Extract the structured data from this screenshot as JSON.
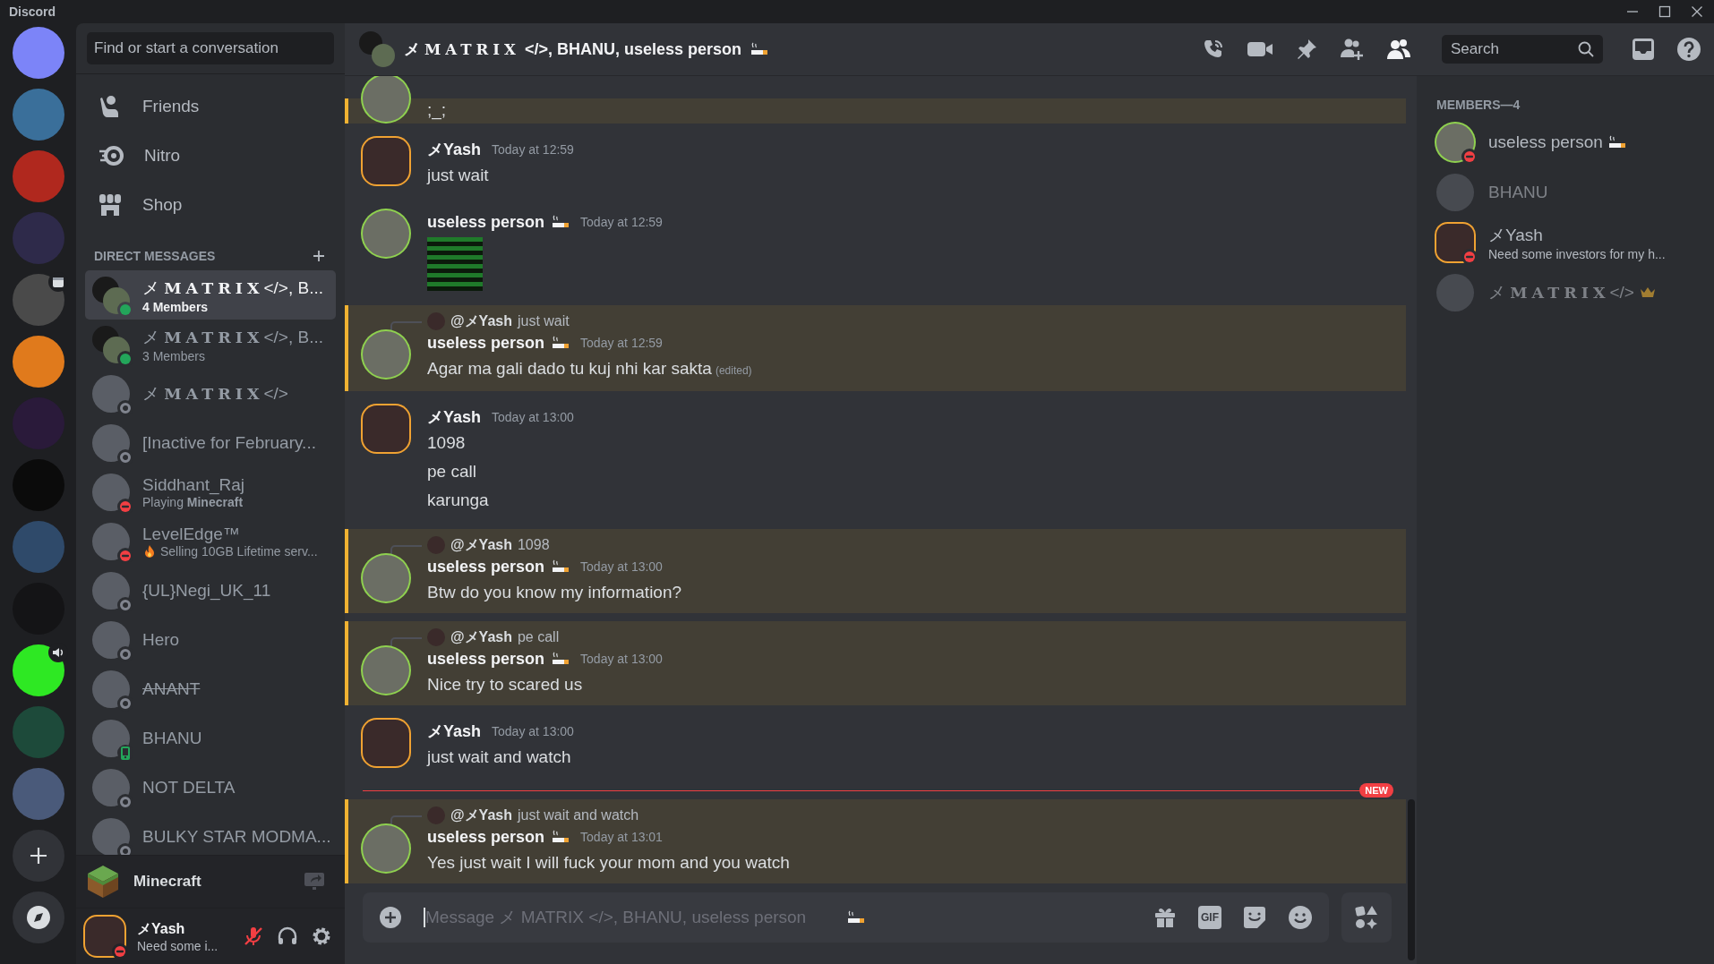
{
  "titlebar": {
    "title": "Discord"
  },
  "servers": [
    {
      "color": "#7c84f8",
      "kind": "plain"
    },
    {
      "color": "#3a6f9a",
      "kind": "plain"
    },
    {
      "color": "#b0281e",
      "kind": "plain"
    },
    {
      "color": "#2e2a4a",
      "kind": "plain"
    },
    {
      "color": "#4a4a4a",
      "kind": "calendar"
    },
    {
      "color": "#e07a1c",
      "kind": "plain"
    },
    {
      "color": "#2a1a3a",
      "kind": "plain"
    },
    {
      "color": "#0b0b0b",
      "kind": "plain"
    },
    {
      "color": "#2f4a6a",
      "kind": "plain"
    },
    {
      "color": "#141416",
      "kind": "plain"
    },
    {
      "color": "#2ee823",
      "kind": "speaker"
    },
    {
      "color": "#1d4a3a",
      "kind": "plain"
    },
    {
      "color": "#4a5a7a",
      "kind": "plain"
    }
  ],
  "search": {
    "placeholder": "Find or start a conversation"
  },
  "nav": [
    {
      "kind": "friends",
      "label": "Friends"
    },
    {
      "kind": "nitro",
      "label": "Nitro"
    },
    {
      "kind": "shop",
      "label": "Shop"
    }
  ],
  "dm_heading": "DIRECT MESSAGES",
  "dms": [
    {
      "name": "メ **MATRIX**</>, B...",
      "sub": "4 Members",
      "kind": "online",
      "group": true,
      "struck": false,
      "fire_icon": false,
      "selected": true
    },
    {
      "name": "メ **MATRIX**</>, B...",
      "sub": "3 Members",
      "kind": "online",
      "group": true,
      "struck": false,
      "fire_icon": false,
      "selected": false
    },
    {
      "name": "メ **MATRIX**</>",
      "kind": "offline",
      "group": false,
      "struck": false,
      "fire_icon": false,
      "selected": false
    },
    {
      "name": "[Inactive for February...",
      "kind": "offline",
      "group": false,
      "struck": false,
      "fire_icon": false,
      "selected": false
    },
    {
      "name": "Siddhant_Raj",
      "sub": "Playing **Minecraft**",
      "kind": "dnd",
      "group": false,
      "struck": false,
      "fire_icon": false,
      "selected": false
    },
    {
      "name": "LevelEdge™",
      "sub": "Selling 10GB Lifetime serv...",
      "kind": "dnd",
      "group": false,
      "struck": false,
      "fire_icon": true,
      "selected": false
    },
    {
      "name": "{UL}Negi_UK_11",
      "kind": "offline",
      "group": false,
      "struck": false,
      "fire_icon": false,
      "selected": false
    },
    {
      "name": "Hero",
      "kind": "offline",
      "group": false,
      "struck": false,
      "fire_icon": false,
      "selected": false
    },
    {
      "name": "ANANT",
      "kind": "offline",
      "group": false,
      "struck": true,
      "fire_icon": false,
      "selected": false
    },
    {
      "name": "BHANU",
      "kind": "mobile",
      "group": false,
      "struck": false,
      "fire_icon": false,
      "selected": false
    },
    {
      "name": "NOT DELTA",
      "kind": "offline",
      "group": false,
      "struck": false,
      "fire_icon": false,
      "selected": false
    },
    {
      "name": "BULKY STAR MODMA...",
      "kind": "offline",
      "group": false,
      "struck": false,
      "fire_icon": false,
      "selected": false
    }
  ],
  "activity": {
    "game": "Minecraft"
  },
  "user": {
    "name": "メYash",
    "status_text": "Need some i...",
    "kind": "dnd",
    "mic_muted": true
  },
  "header": {
    "title": "メ **MATRIX** </>, BHANU, useless person",
    "cigarette_emoji": true,
    "search_placeholder": "Search"
  },
  "messages": [
    {
      "kind": "continuation",
      "highlighted": true,
      "lines": [
        ";_;"
      ]
    },
    {
      "kind": "message",
      "author": "メYash",
      "cigarette_emoji": false,
      "hexagon_avatar": true,
      "image_attachment": false,
      "time": "Today at 12:59",
      "lines": [
        "just wait"
      ],
      "highlighted": false
    },
    {
      "kind": "message",
      "author": "useless person",
      "cigarette_emoji": true,
      "hexagon_avatar": false,
      "image_attachment": true,
      "time": "Today at 12:59",
      "highlighted": false
    },
    {
      "kind": "message",
      "reply": {
        "author": "@メYash",
        "text": "just wait"
      },
      "author": "useless person",
      "cigarette_emoji": true,
      "hexagon_avatar": false,
      "image_attachment": false,
      "time": "Today at 12:59",
      "lines": [
        "Agar ma gali  dado tu kuj nhi kar sakta"
      ],
      "edited": "(edited)",
      "highlighted": true
    },
    {
      "kind": "message",
      "author": "メYash",
      "cigarette_emoji": false,
      "hexagon_avatar": true,
      "image_attachment": false,
      "time": "Today at 13:00",
      "lines": [
        "1098",
        "pe call",
        "karunga"
      ],
      "highlighted": false
    },
    {
      "kind": "message",
      "reply": {
        "author": "@メYash",
        "text": "1098"
      },
      "author": "useless person",
      "cigarette_emoji": true,
      "hexagon_avatar": false,
      "image_attachment": false,
      "time": "Today at 13:00",
      "lines": [
        "Btw do you know my information?"
      ],
      "highlighted": true
    },
    {
      "kind": "message",
      "reply": {
        "author": "@メYash",
        "text": "pe call"
      },
      "author": "useless person",
      "cigarette_emoji": true,
      "hexagon_avatar": false,
      "image_attachment": false,
      "time": "Today at 13:00",
      "lines": [
        "Nice try to scared us"
      ],
      "highlighted": true
    },
    {
      "kind": "message",
      "author": "メYash",
      "cigarette_emoji": false,
      "hexagon_avatar": true,
      "image_attachment": false,
      "time": "Today at 13:00",
      "lines": [
        "just wait and watch"
      ],
      "highlighted": false
    },
    {
      "kind": "divider",
      "label": "NEW"
    },
    {
      "kind": "message",
      "reply": {
        "author": "@メYash",
        "text": "just wait and watch"
      },
      "author": "useless person",
      "cigarette_emoji": true,
      "hexagon_avatar": false,
      "image_attachment": false,
      "time": "Today at 13:01",
      "lines": [
        "Yes just wait I will fuck your mom and you watch"
      ],
      "highlighted": true
    }
  ],
  "compose": {
    "placeholder": "Message メ MATRIX </>, BHANU, useless person",
    "cigarette_emoji": true,
    "gif_label": "GIF"
  },
  "members": {
    "heading": "MEMBERS—4",
    "items": [
      {
        "name": "useless person",
        "kind": "dnd",
        "cigarette_emoji": true,
        "hexagon_avatar": false,
        "ring_avatar": true,
        "owner": false
      },
      {
        "name": "BHANU",
        "kind": "offline",
        "cigarette_emoji": false,
        "hexagon_avatar": false,
        "ring_avatar": false,
        "owner": false
      },
      {
        "name": "メYash",
        "sub": "Need some investors for my h...",
        "kind": "dnd",
        "cigarette_emoji": false,
        "hexagon_avatar": true,
        "ring_avatar": false,
        "owner": false
      },
      {
        "name": "メ **MATRIX**</>",
        "kind": "offline",
        "cigarette_emoji": false,
        "hexagon_avatar": false,
        "ring_avatar": false,
        "owner": true
      }
    ]
  }
}
